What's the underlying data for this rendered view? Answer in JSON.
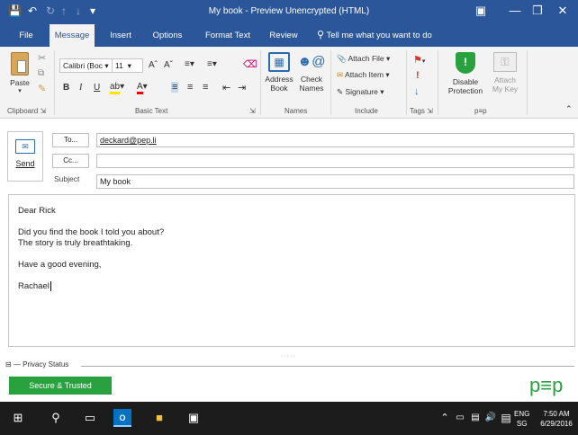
{
  "window": {
    "title": "My book - Preview Unencrypted (HTML)"
  },
  "tabs": [
    "File",
    "Message",
    "Insert",
    "Options",
    "Format Text",
    "Review"
  ],
  "tell_me": "Tell me what you want to do",
  "ribbon": {
    "paste": "Paste",
    "font_name": "Calibri (Boc",
    "font_size": "11",
    "bold": "B",
    "italic": "I",
    "underline": "U",
    "address_book": "Address Book",
    "check_names": "Check Names",
    "attach_file": "Attach File",
    "attach_item": "Attach Item",
    "signature": "Signature",
    "disable_protection": "Disable Protection",
    "attach_my_key": "Attach My Key",
    "groups": {
      "clipboard": "Clipboard",
      "basic_text": "Basic Text",
      "names": "Names",
      "include": "Include",
      "tags": "Tags",
      "pep": "p≡p"
    }
  },
  "compose": {
    "send": "Send",
    "to_label": "To...",
    "cc_label": "Cc...",
    "subject_label": "Subject",
    "to_value": "deckard@pep.li",
    "cc_value": "",
    "subject_value": "My book"
  },
  "body_lines": [
    "Dear Rick",
    "",
    "Did you find the book I told you about?",
    "The story is truly breathtaking.",
    "",
    "Have a good evening,",
    "",
    "Rachael"
  ],
  "privacy": {
    "header": "Privacy Status",
    "status": "Secure & Trusted",
    "logo": "p≡p",
    "status_color": "#2aa13f"
  },
  "taskbar": {
    "lang": "ENG",
    "region": "SG",
    "time": "7:50 AM",
    "date": "6/29/2016"
  }
}
